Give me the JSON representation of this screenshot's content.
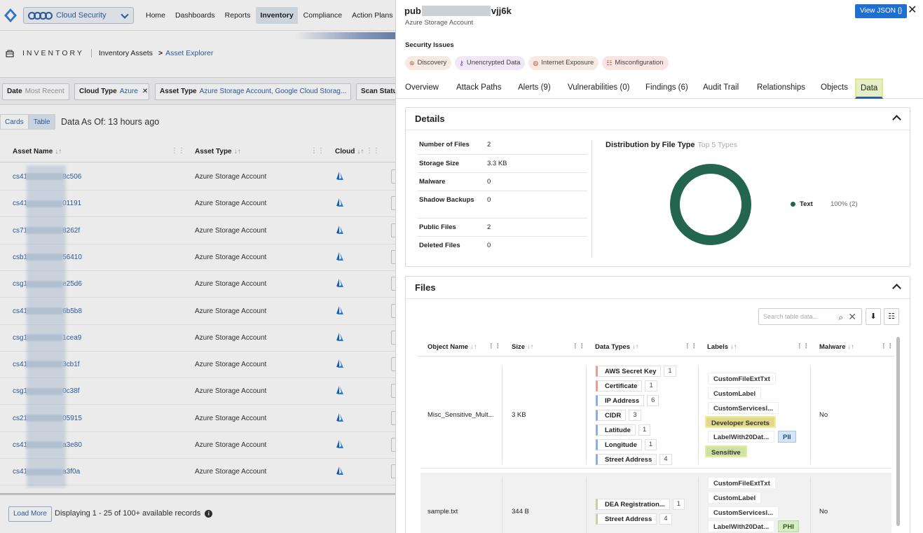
{
  "topnav": {
    "product": "Cloud Security",
    "links": [
      "Home",
      "Dashboards",
      "Reports",
      "Inventory",
      "Compliance",
      "Action Plans"
    ],
    "active": "Inventory"
  },
  "breadcrumb": {
    "section": "INVENTORY",
    "level1": "Inventory Assets",
    "level2": "Asset Explorer"
  },
  "filters": [
    {
      "key": "Date",
      "value": "Most Recent"
    },
    {
      "key": "Cloud Type",
      "value": "Azure"
    },
    {
      "key": "Asset Type",
      "value": "Azure Storage Account, Google Cloud Storag..."
    },
    {
      "key": "Scan Status",
      "value": ""
    }
  ],
  "view": {
    "cards": "Cards",
    "table": "Table",
    "as_of_label": "Data As Of:",
    "as_of_value": "13 hours ago"
  },
  "asset_table": {
    "columns": [
      "Asset Name",
      "Asset Type",
      "Cloud"
    ],
    "rows": [
      {
        "prefix": "cs41",
        "suffix": "8c506",
        "type": "Azure Storage Account"
      },
      {
        "prefix": "cs41",
        "suffix": "01191",
        "type": "Azure Storage Account"
      },
      {
        "prefix": "cs71",
        "suffix": "8262f",
        "type": "Azure Storage Account"
      },
      {
        "prefix": "csb1",
        "suffix": "56410",
        "type": "Azure Storage Account"
      },
      {
        "prefix": "csg1",
        "suffix": "e25d6",
        "type": "Azure Storage Account"
      },
      {
        "prefix": "cs41",
        "suffix": "6b5b8",
        "type": "Azure Storage Account"
      },
      {
        "prefix": "csg1",
        "suffix": "1cea9",
        "type": "Azure Storage Account"
      },
      {
        "prefix": "cs41",
        "suffix": "3cb1f",
        "type": "Azure Storage Account"
      },
      {
        "prefix": "csg1",
        "suffix": "0c38f",
        "type": "Azure Storage Account"
      },
      {
        "prefix": "cs21",
        "suffix": "05915",
        "type": "Azure Storage Account"
      },
      {
        "prefix": "cs41",
        "suffix": "a3e80",
        "type": "Azure Storage Account"
      },
      {
        "prefix": "cs41",
        "suffix": "a3f0a",
        "type": "Azure Storage Account"
      }
    ]
  },
  "footer": {
    "load_more": "Load More",
    "displaying": "Displaying 1 - 25 of 100+ available records"
  },
  "panel": {
    "title_prefix": "pub",
    "title_suffix": "vjj6k",
    "subtitle": "Azure Storage Account",
    "view_json": "View JSON {}",
    "security_issues_label": "Security Issues",
    "issues": [
      "Discovery",
      "Unencrypted Data",
      "Internet Exposure",
      "Misconfiguration"
    ],
    "tabs": [
      "Overview",
      "Attack Paths",
      "Alerts (9)",
      "Vulnerabilities (0)",
      "Findings (6)",
      "Audit Trail",
      "Relationships",
      "Objects",
      "Data"
    ],
    "active_tab": "Data"
  },
  "details": {
    "title": "Details",
    "rows": [
      {
        "label": "Number of Files",
        "value": "2"
      },
      {
        "label": "Storage Size",
        "value": "3.3 KB"
      },
      {
        "label": "Malware",
        "value": "0"
      },
      {
        "label": "Shadow Backups",
        "value": "0"
      },
      {
        "label": "Public Files",
        "value": "2"
      },
      {
        "label": "Deleted Files",
        "value": "0"
      }
    ],
    "distribution_title": "Distribution by File Type",
    "distribution_hint": "Top 5 Types",
    "distribution": [
      {
        "type": "Text",
        "value": "100% (2)"
      }
    ],
    "donut_color": "#24654f"
  },
  "files": {
    "title": "Files",
    "search_placeholder": "Search table data...",
    "columns": [
      "Object Name",
      "Size",
      "Data Types",
      "Labels",
      "Malware"
    ],
    "rows": [
      {
        "name": "Misc_Sensitive_Mult...",
        "size": "3 KB",
        "data_types": [
          {
            "name": "AWS Secret Key",
            "count": "1"
          },
          {
            "name": "Certificate",
            "count": "1"
          },
          {
            "name": "IP Address",
            "count": "6"
          },
          {
            "name": "CIDR",
            "count": "3"
          },
          {
            "name": "Latitude",
            "count": "1"
          },
          {
            "name": "Longitude",
            "count": "1"
          },
          {
            "name": "Street Address",
            "count": "4"
          }
        ],
        "labels": [
          "CustomFileExtTxt",
          "CustomLabel",
          "CustomServicesl...",
          "Developer Secrets",
          "LabelWith20Dat...",
          "Sensitive"
        ],
        "label_badge": "PII",
        "malware": "No"
      },
      {
        "name": "sample.txt",
        "size": "344 B",
        "data_types": [
          {
            "name": "DEA Registration...",
            "count": "1"
          },
          {
            "name": "Street Address",
            "count": "4"
          }
        ],
        "labels": [
          "CustomFileExtTxt",
          "CustomLabel",
          "CustomServicesl...",
          "LabelWith20Dat..."
        ],
        "label_badge": "PHI",
        "malware": "No"
      }
    ]
  }
}
